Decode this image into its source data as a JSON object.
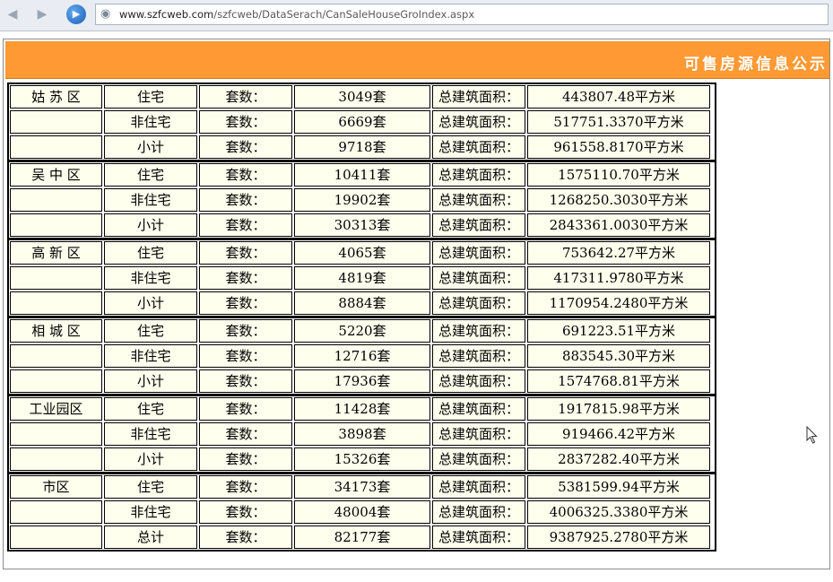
{
  "browser": {
    "url_host": "www.szfcweb.com",
    "url_path": "/szfcweb/DataSerach/CanSaleHouseGroIndex.aspx"
  },
  "page": {
    "title": "可售房源信息公示",
    "count_label": "套数：",
    "area_label": "总建筑面积："
  },
  "districts": [
    {
      "name": "姑 苏 区",
      "rows": [
        {
          "type": "住宅",
          "count": "3049套",
          "area": "443807.48平方米"
        },
        {
          "type": "非住宅",
          "count": "6669套",
          "area": "517751.3370平方米"
        },
        {
          "type": "小计",
          "count": "9718套",
          "area": "961558.8170平方米"
        }
      ]
    },
    {
      "name": "吴 中 区",
      "rows": [
        {
          "type": "住宅",
          "count": "10411套",
          "area": "1575110.70平方米"
        },
        {
          "type": "非住宅",
          "count": "19902套",
          "area": "1268250.3030平方米"
        },
        {
          "type": "小计",
          "count": "30313套",
          "area": "2843361.0030平方米"
        }
      ]
    },
    {
      "name": "高 新 区",
      "rows": [
        {
          "type": "住宅",
          "count": "4065套",
          "area": "753642.27平方米"
        },
        {
          "type": "非住宅",
          "count": "4819套",
          "area": "417311.9780平方米"
        },
        {
          "type": "小计",
          "count": "8884套",
          "area": "1170954.2480平方米"
        }
      ]
    },
    {
      "name": "相 城 区",
      "rows": [
        {
          "type": "住宅",
          "count": "5220套",
          "area": "691223.51平方米"
        },
        {
          "type": "非住宅",
          "count": "12716套",
          "area": "883545.30平方米"
        },
        {
          "type": "小计",
          "count": "17936套",
          "area": "1574768.81平方米"
        }
      ]
    },
    {
      "name": "工业园区",
      "rows": [
        {
          "type": "住宅",
          "count": "11428套",
          "area": "1917815.98平方米"
        },
        {
          "type": "非住宅",
          "count": "3898套",
          "area": "919466.42平方米"
        },
        {
          "type": "小计",
          "count": "15326套",
          "area": "2837282.40平方米"
        }
      ]
    },
    {
      "name": "市区",
      "rows": [
        {
          "type": "住宅",
          "count": "34173套",
          "area": "5381599.94平方米"
        },
        {
          "type": "非住宅",
          "count": "48004套",
          "area": "4006325.3380平方米"
        },
        {
          "type": "总计",
          "count": "82177套",
          "area": "9387925.2780平方米"
        }
      ]
    }
  ]
}
